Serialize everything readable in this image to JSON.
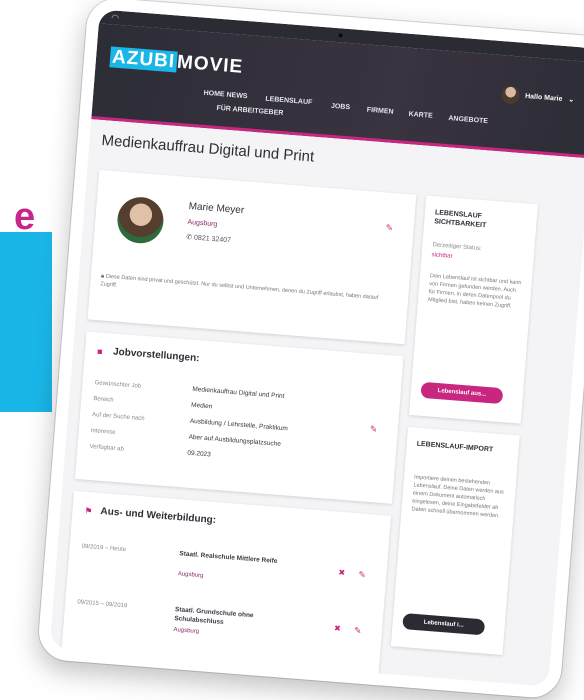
{
  "promo": {
    "letter": "e"
  },
  "header": {
    "logo_part1": "AZUBI",
    "logo_part2": "MOVIE",
    "user_name": "Hallo Marie",
    "nav": [
      "HOME NEWS",
      "LEBENSLAUF",
      "JOBS",
      "FIRMEN",
      "KARTE",
      "ANGEBOTE",
      "FÜR ARBEITGEBER"
    ]
  },
  "page_title": "Medienkauffrau Digital und Print",
  "profile": {
    "name": "Marie Meyer",
    "city": "Augsburg",
    "phone": "0821 32407",
    "note": "Diese Daten sind privat und geschützt. Nur du selbst und Unternehmen, denen du Zugriff erlaubst, haben darauf Zugriff."
  },
  "jobs": {
    "title": "Jobvorstellungen:",
    "labels": [
      "Gewünschter Job",
      "Bereich",
      "Auf der Suche nach",
      "Interesse",
      "Verfügbar ab"
    ],
    "values": [
      "Medienkauffrau Digital und Print",
      "Medien",
      "Ausbildung / Lehrstelle, Praktikum",
      "Aber auf Ausbildungsplatzsuche",
      "09.2023"
    ]
  },
  "education": {
    "title": "Aus- und Weiterbildung:",
    "items": [
      {
        "date": "09/2019 – Heute",
        "school": "Staatl. Realschule Mittlere Reife",
        "city": "Augsburg"
      },
      {
        "date": "09/2015 – 09/2019",
        "school": "Staatl. Grundschule ohne Schulabschluss",
        "city": "Augsburg"
      }
    ]
  },
  "sidebar": {
    "box1": {
      "title": "LEBENSLAUF SICHTBARKEIT",
      "status_label": "Derzeitiger Status:",
      "status_value": "sichtbar",
      "text": "Dein Lebenslauf ist sichtbar und kann von Firmen gefunden werden. Auch für Firmen, in deren Datenpool du Mitglied bist, haben keinen Zugriff.",
      "button": "Lebenslauf aus..."
    },
    "box2": {
      "title": "LEBENSLAUF-IMPORT",
      "text": "Importiere deinen bestehenden Lebenslauf. Deine Daten werden aus einem Dokument automatisch eingelesen, deine Eingabefelder ab Daten schnell übernommen werden.",
      "button": "Lebenslauf i..."
    }
  },
  "colors": {
    "accent": "#c9267f",
    "brand_cyan": "#1ab6e8",
    "header": "#2c2d36"
  }
}
